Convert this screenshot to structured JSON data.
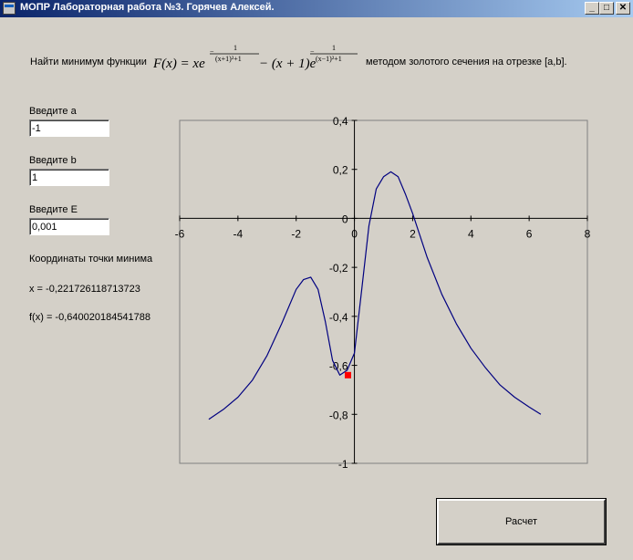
{
  "window": {
    "title": "МОПР Лабораторная работа №3. Горячев Алексей.",
    "min_glyph": "_",
    "max_glyph": "□",
    "close_glyph": "✕"
  },
  "task": {
    "prefix": "Найти минимум функции",
    "suffix": "методом золотого сечения на отрезке [a,b].",
    "formula": {
      "lhs": "F(x) = xe",
      "middle": " − (x + 1)e",
      "exp1_num": "1",
      "exp1_den": "(x+1)²+1",
      "exp2_num": "1",
      "exp2_den": "(x−1)²+1"
    }
  },
  "inputs": {
    "a_label": "Введите a",
    "a_value": "-1",
    "b_label": "Введите b",
    "b_value": "1",
    "e_label": "Введите E",
    "e_value": "0,001"
  },
  "results": {
    "heading": "Координаты точки минима",
    "x_text": "x = -0,221726118713723",
    "fx_text": "f(x) = -0,640020184541788"
  },
  "calc_button": "Расчет",
  "chart_data": {
    "type": "line",
    "xlim": [
      -6,
      8
    ],
    "ylim": [
      -1,
      0.4
    ],
    "x_ticks": [
      "-6",
      "-4",
      "-2",
      "0",
      "2",
      "4",
      "6",
      "8"
    ],
    "y_ticks": [
      "0,4",
      "0,2",
      "0",
      "-0,2",
      "-0,4",
      "-0,6",
      "-0,8",
      "-1"
    ],
    "series": [
      {
        "color": "#000080",
        "x": [
          -5.0,
          -4.5,
          -4.0,
          -3.5,
          -3.0,
          -2.5,
          -2.0,
          -1.75,
          -1.5,
          -1.25,
          -1.0,
          -0.75,
          -0.5,
          -0.25,
          0.0,
          0.25,
          0.5,
          0.75,
          1.0,
          1.25,
          1.5,
          1.75,
          2.0,
          2.5,
          3.0,
          3.5,
          4.0,
          4.5,
          5.0,
          5.5,
          6.0,
          6.4
        ],
        "y": [
          -0.82,
          -0.78,
          -0.73,
          -0.66,
          -0.56,
          -0.43,
          -0.29,
          -0.25,
          -0.24,
          -0.29,
          -0.42,
          -0.58,
          -0.64,
          -0.62,
          -0.55,
          -0.29,
          -0.03,
          0.12,
          0.17,
          0.19,
          0.17,
          0.1,
          0.02,
          -0.16,
          -0.31,
          -0.43,
          -0.53,
          -0.61,
          -0.68,
          -0.73,
          -0.77,
          -0.8
        ]
      }
    ],
    "marker": {
      "x": -0.221726118713723,
      "y": -0.640020184541788,
      "color": "#ff0000"
    },
    "axis_color": "#000000",
    "frame_color": "#808080"
  }
}
